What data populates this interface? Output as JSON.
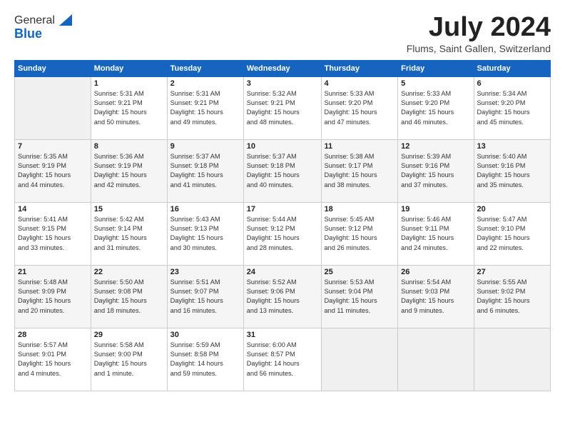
{
  "header": {
    "logo_line1": "General",
    "logo_line2": "Blue",
    "month_title": "July 2024",
    "location": "Flums, Saint Gallen, Switzerland"
  },
  "days_of_week": [
    "Sunday",
    "Monday",
    "Tuesday",
    "Wednesday",
    "Thursday",
    "Friday",
    "Saturday"
  ],
  "weeks": [
    [
      {
        "day": "",
        "info": ""
      },
      {
        "day": "1",
        "info": "Sunrise: 5:31 AM\nSunset: 9:21 PM\nDaylight: 15 hours\nand 50 minutes."
      },
      {
        "day": "2",
        "info": "Sunrise: 5:31 AM\nSunset: 9:21 PM\nDaylight: 15 hours\nand 49 minutes."
      },
      {
        "day": "3",
        "info": "Sunrise: 5:32 AM\nSunset: 9:21 PM\nDaylight: 15 hours\nand 48 minutes."
      },
      {
        "day": "4",
        "info": "Sunrise: 5:33 AM\nSunset: 9:20 PM\nDaylight: 15 hours\nand 47 minutes."
      },
      {
        "day": "5",
        "info": "Sunrise: 5:33 AM\nSunset: 9:20 PM\nDaylight: 15 hours\nand 46 minutes."
      },
      {
        "day": "6",
        "info": "Sunrise: 5:34 AM\nSunset: 9:20 PM\nDaylight: 15 hours\nand 45 minutes."
      }
    ],
    [
      {
        "day": "7",
        "info": "Sunrise: 5:35 AM\nSunset: 9:19 PM\nDaylight: 15 hours\nand 44 minutes."
      },
      {
        "day": "8",
        "info": "Sunrise: 5:36 AM\nSunset: 9:19 PM\nDaylight: 15 hours\nand 42 minutes."
      },
      {
        "day": "9",
        "info": "Sunrise: 5:37 AM\nSunset: 9:18 PM\nDaylight: 15 hours\nand 41 minutes."
      },
      {
        "day": "10",
        "info": "Sunrise: 5:37 AM\nSunset: 9:18 PM\nDaylight: 15 hours\nand 40 minutes."
      },
      {
        "day": "11",
        "info": "Sunrise: 5:38 AM\nSunset: 9:17 PM\nDaylight: 15 hours\nand 38 minutes."
      },
      {
        "day": "12",
        "info": "Sunrise: 5:39 AM\nSunset: 9:16 PM\nDaylight: 15 hours\nand 37 minutes."
      },
      {
        "day": "13",
        "info": "Sunrise: 5:40 AM\nSunset: 9:16 PM\nDaylight: 15 hours\nand 35 minutes."
      }
    ],
    [
      {
        "day": "14",
        "info": "Sunrise: 5:41 AM\nSunset: 9:15 PM\nDaylight: 15 hours\nand 33 minutes."
      },
      {
        "day": "15",
        "info": "Sunrise: 5:42 AM\nSunset: 9:14 PM\nDaylight: 15 hours\nand 31 minutes."
      },
      {
        "day": "16",
        "info": "Sunrise: 5:43 AM\nSunset: 9:13 PM\nDaylight: 15 hours\nand 30 minutes."
      },
      {
        "day": "17",
        "info": "Sunrise: 5:44 AM\nSunset: 9:12 PM\nDaylight: 15 hours\nand 28 minutes."
      },
      {
        "day": "18",
        "info": "Sunrise: 5:45 AM\nSunset: 9:12 PM\nDaylight: 15 hours\nand 26 minutes."
      },
      {
        "day": "19",
        "info": "Sunrise: 5:46 AM\nSunset: 9:11 PM\nDaylight: 15 hours\nand 24 minutes."
      },
      {
        "day": "20",
        "info": "Sunrise: 5:47 AM\nSunset: 9:10 PM\nDaylight: 15 hours\nand 22 minutes."
      }
    ],
    [
      {
        "day": "21",
        "info": "Sunrise: 5:48 AM\nSunset: 9:09 PM\nDaylight: 15 hours\nand 20 minutes."
      },
      {
        "day": "22",
        "info": "Sunrise: 5:50 AM\nSunset: 9:08 PM\nDaylight: 15 hours\nand 18 minutes."
      },
      {
        "day": "23",
        "info": "Sunrise: 5:51 AM\nSunset: 9:07 PM\nDaylight: 15 hours\nand 16 minutes."
      },
      {
        "day": "24",
        "info": "Sunrise: 5:52 AM\nSunset: 9:06 PM\nDaylight: 15 hours\nand 13 minutes."
      },
      {
        "day": "25",
        "info": "Sunrise: 5:53 AM\nSunset: 9:04 PM\nDaylight: 15 hours\nand 11 minutes."
      },
      {
        "day": "26",
        "info": "Sunrise: 5:54 AM\nSunset: 9:03 PM\nDaylight: 15 hours\nand 9 minutes."
      },
      {
        "day": "27",
        "info": "Sunrise: 5:55 AM\nSunset: 9:02 PM\nDaylight: 15 hours\nand 6 minutes."
      }
    ],
    [
      {
        "day": "28",
        "info": "Sunrise: 5:57 AM\nSunset: 9:01 PM\nDaylight: 15 hours\nand 4 minutes."
      },
      {
        "day": "29",
        "info": "Sunrise: 5:58 AM\nSunset: 9:00 PM\nDaylight: 15 hours\nand 1 minute."
      },
      {
        "day": "30",
        "info": "Sunrise: 5:59 AM\nSunset: 8:58 PM\nDaylight: 14 hours\nand 59 minutes."
      },
      {
        "day": "31",
        "info": "Sunrise: 6:00 AM\nSunset: 8:57 PM\nDaylight: 14 hours\nand 56 minutes."
      },
      {
        "day": "",
        "info": ""
      },
      {
        "day": "",
        "info": ""
      },
      {
        "day": "",
        "info": ""
      }
    ]
  ]
}
